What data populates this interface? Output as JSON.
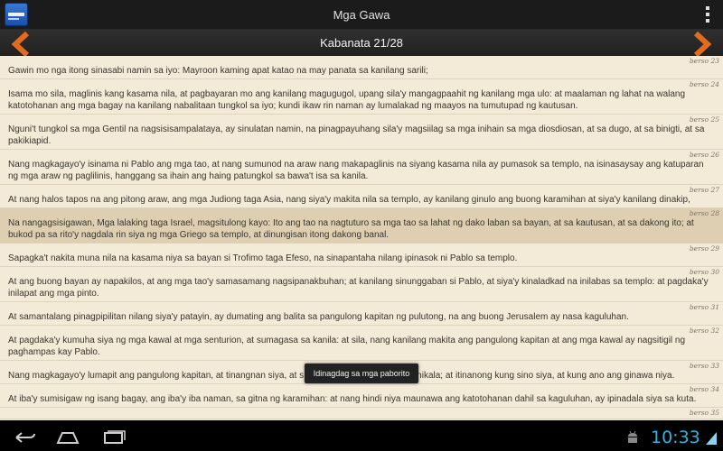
{
  "app": {
    "title": "Mga Gawa",
    "icon": "bible-book-icon",
    "icon_label": "BibleApp"
  },
  "nav": {
    "chapter_label": "Kabanata 21/28",
    "prev_icon": "chevron-left-icon",
    "next_icon": "chevron-right-icon",
    "accent": "#e36b1d"
  },
  "verses": [
    {
      "num": "berso 23",
      "text": "Gawin mo nga itong sinasabi namin sa iyo: Mayroon kaming apat katao na may panata sa kanilang sarili;",
      "selected": false
    },
    {
      "num": "berso 24",
      "text": "Isama mo sila, maglinis kang kasama nila, at pagbayaran mo ang kanilang magugugol, upang sila'y mangagpaahit ng kanilang mga ulo: at maalaman ng lahat na walang katotohanan ang mga bagay na kanilang nabalitaan tungkol sa iyo; kundi ikaw rin naman ay lumalakad ng maayos na tumutupad ng kautusan.",
      "selected": false
    },
    {
      "num": "berso 25",
      "text": "Nguni't tungkol sa mga Gentil na nagsisisampalataya, ay sinulatan namin, na pinagpayuhang sila'y magsiilag sa mga inihain sa mga diosdiosan, at sa dugo, at sa binigti, at sa pakikiapid.",
      "selected": false
    },
    {
      "num": "berso 26",
      "text": "Nang magkagayo'y isinama ni Pablo ang mga tao, at nang sumunod na araw nang makapaglinis na siyang kasama nila ay pumasok sa templo, na isinasaysay ang katuparan ng mga araw ng paglilinis, hanggang sa ihain ang haing patungkol sa bawa't isa sa kanila.",
      "selected": false
    },
    {
      "num": "berso 27",
      "text": "At nang halos tapos na ang pitong araw, ang mga Judiong taga Asia, nang siya'y makita nila sa templo, ay kanilang ginulo ang buong karamihan at siya'y kanilang dinakip,",
      "selected": false
    },
    {
      "num": "berso 28",
      "text": "Na nangagsisigawan, Mga lalaking taga Israel, magsitulong kayo: Ito ang tao na nagtuturo sa mga tao sa lahat ng dako laban sa bayan, at sa kautusan, at sa dakong ito; at bukod pa sa rito'y nagdala rin siya ng mga Griego sa templo, at dinungisan itong dakong banal.",
      "selected": true
    },
    {
      "num": "berso 29",
      "text": "Sapagka't nakita muna nila na kasama niya sa bayan si Trofimo taga Efeso, na sinapantaha nilang ipinasok ni Pablo sa templo.",
      "selected": false
    },
    {
      "num": "berso 30",
      "text": "At ang buong bayan ay napakilos, at ang mga tao'y samasamang nagsipanakbuhan; at kanilang sinunggaban si Pablo, at siya'y kinaladkad na inilabas sa templo: at pagdaka'y inilapat ang mga pinto.",
      "selected": false
    },
    {
      "num": "berso 31",
      "text": "At samantalang pinagpipilitan nilang siya'y patayin, ay dumating ang balita sa pangulong kapitan ng pulutong, na ang buong Jerusalem ay nasa kaguluhan.",
      "selected": false
    },
    {
      "num": "berso 32",
      "text": "At pagdaka'y kumuha siya ng mga kawal at mga senturion, at sumagasa sa kanila: at sila, nang kanilang makita ang pangulong kapitan at ang mga kawal ay nagsitigil ng paghampas kay Pablo.",
      "selected": false
    },
    {
      "num": "berso 33",
      "text": "Nang magkagayo'y lumapit ang pangulong kapitan, at tinangnan siya, at s                                          tanikala; at itinanong kung sino siya, at kung ano ang ginawa niya.",
      "selected": false
    },
    {
      "num": "berso 34",
      "text": "At iba'y sumisigaw ng isang bagay, ang iba'y iba naman, sa gitna ng karamihan: at nang hindi niya maunawa ang katotohanan dahil sa kaguluhan, ay ipinadala siya sa kuta.",
      "selected": false
    },
    {
      "num": "berso 35",
      "text": "",
      "selected": false
    }
  ],
  "toast": {
    "text": "Idinagdag sa mga paborito"
  },
  "system": {
    "clock": "10:33",
    "clock_color": "#2fb3e0",
    "back_icon": "back-icon",
    "home_icon": "home-icon",
    "recent_icon": "recent-apps-icon"
  }
}
